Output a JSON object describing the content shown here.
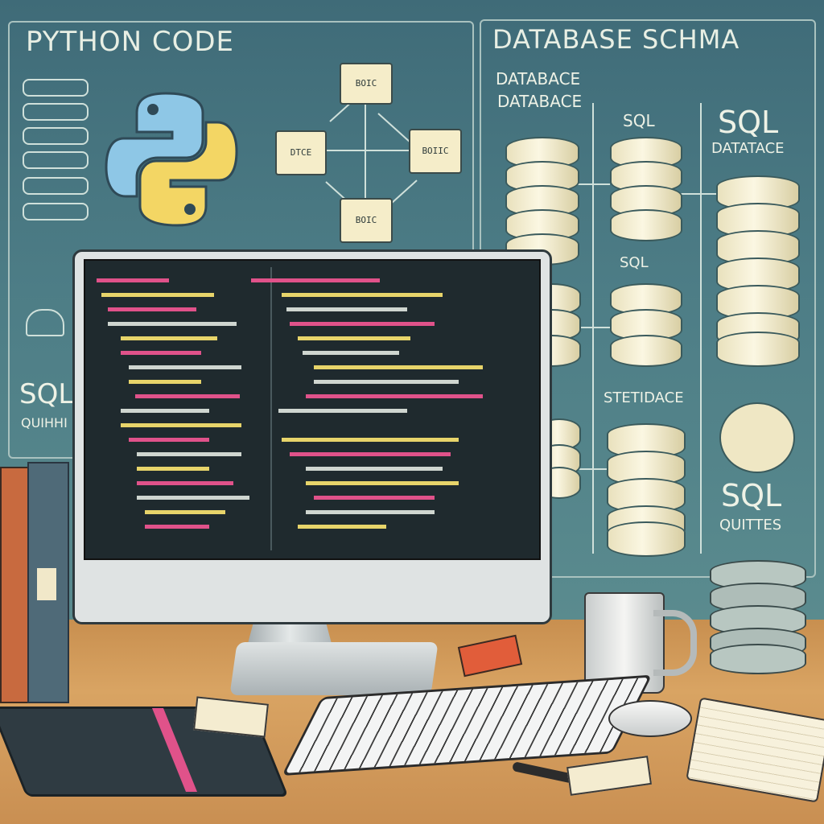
{
  "python_panel": {
    "title": "PYTHON CODE"
  },
  "schema_panel": {
    "title": "DATABASE SCHMA",
    "database_label_1": "DATABACE",
    "database_label_2": "DATABACE",
    "sql_label_1": "SQL",
    "sql_label_2": "DATATACE",
    "sql_label_3": "SQL",
    "sql_label_4": "SQL",
    "statement_label": "STETIDACE",
    "sql_queries_title": "SQL",
    "sql_queries_sub": "QUITTES"
  },
  "left_panel": {
    "sql_title": "SQL",
    "sql_sub": "QUIHHI"
  },
  "diagram_nodes": [
    "BOIC",
    "DTCE",
    "BOIIC",
    "BOIC"
  ],
  "colors": {
    "wall": "#4d7d86",
    "desk": "#d9a463",
    "screen": "#1f2a2e",
    "accent_pink": "#e0528a",
    "accent_yellow": "#e7d46a"
  },
  "icons": [
    "python-logo-icon",
    "database-icon",
    "coffee-mug-icon",
    "keyboard-icon",
    "mouse-icon"
  ]
}
